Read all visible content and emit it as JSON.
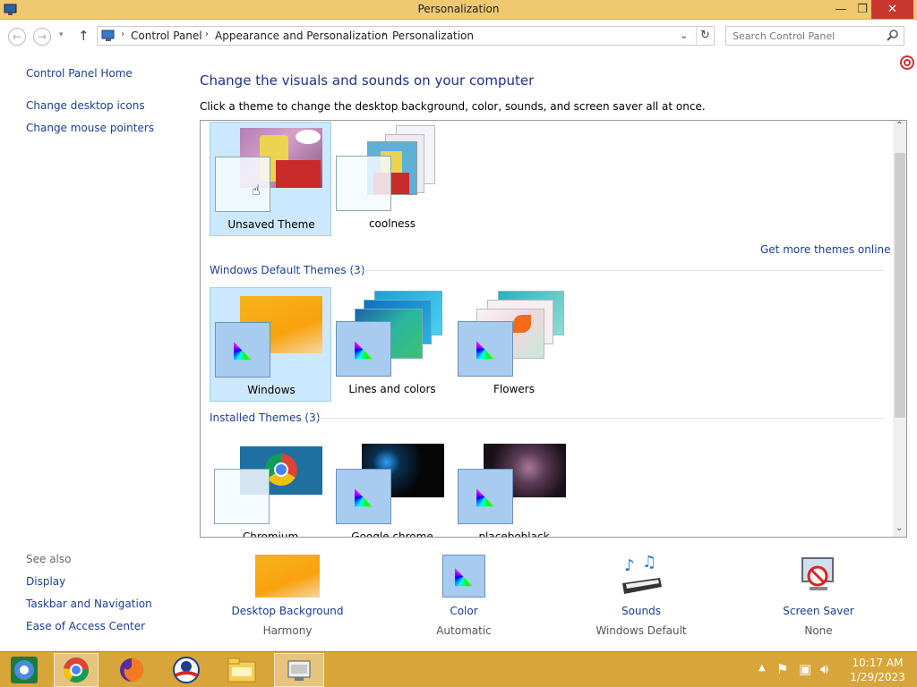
{
  "window": {
    "title": "Personalization",
    "minimize_label": "—",
    "restore_label": "❐",
    "close_label": "✕"
  },
  "address": {
    "crumbs": [
      "Control Panel",
      "Appearance and Personalization",
      "Personalization"
    ],
    "search_placeholder": "Search Control Panel"
  },
  "sidebar": {
    "home": "Control Panel Home",
    "items": [
      "Change desktop icons",
      "Change mouse pointers"
    ],
    "see_also": "See also",
    "see_also_items": [
      "Display",
      "Taskbar and Navigation",
      "Ease of Access Center"
    ]
  },
  "main": {
    "heading": "Change the visuals and sounds on your computer",
    "description": "Click a theme to change the desktop background, color, sounds, and screen saver all at once.",
    "my_themes": [
      {
        "name": "Unsaved Theme",
        "selected": true
      },
      {
        "name": "coolness",
        "selected": false
      }
    ],
    "get_more": "Get more themes online",
    "default_group": "Windows Default Themes (3)",
    "default_themes": [
      {
        "name": "Windows",
        "selected": true
      },
      {
        "name": "Lines and colors",
        "selected": false
      },
      {
        "name": "Flowers",
        "selected": false
      }
    ],
    "installed_group": "Installed Themes (3)",
    "installed_themes": [
      {
        "name": "Chromium"
      },
      {
        "name": "Google chrome"
      },
      {
        "name": "placeboblack"
      }
    ]
  },
  "bottom": [
    {
      "label": "Desktop Background",
      "value": "Harmony"
    },
    {
      "label": "Color",
      "value": "Automatic"
    },
    {
      "label": "Sounds",
      "value": "Windows Default"
    },
    {
      "label": "Screen Saver",
      "value": "None"
    }
  ],
  "taskbar": {
    "time": "10:17 AM",
    "date": "1/29/2023"
  },
  "colors": {
    "titlebar": "#f0c871",
    "taskbar": "#d8a53a",
    "link": "#1b3f8f",
    "selection": "#cce8ff"
  }
}
